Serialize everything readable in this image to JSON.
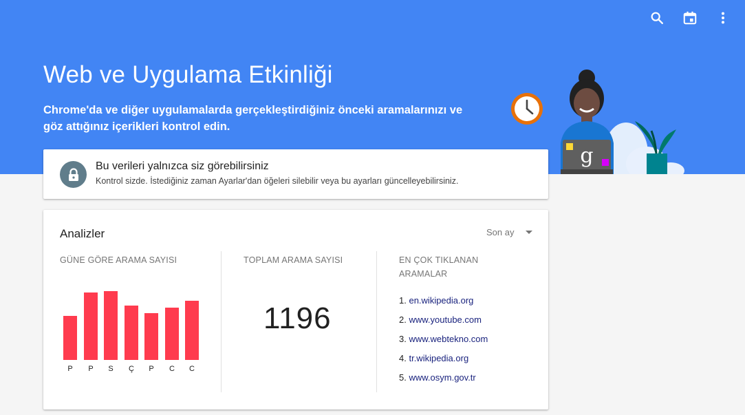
{
  "toolbar": {
    "search_icon": "search-icon",
    "calendar_icon": "calendar-icon",
    "more_icon": "more-vert-icon"
  },
  "header": {
    "title": "Web ve Uygulama Etkinliği",
    "subtitle": "Chrome'da ve diğer uygulamalarda gerçekleştirdiğiniz önceki aramalarınızı ve göz attığınız içerikleri kontrol edin."
  },
  "privacy": {
    "title": "Bu verileri yalnızca siz görebilirsiniz",
    "description": "Kontrol sizde. İstediğiniz zaman Ayarlar'dan öğeleri silebilir veya bu ayarları güncelleyebilirsiniz."
  },
  "analytics": {
    "title": "Analizler",
    "period": "Son ay",
    "daily_header": "GÜNE GÖRE ARAMA SAYISI",
    "total_header": "TOPLAM ARAMA SAYISI",
    "total_value": "1196",
    "top_header_line1": "EN ÇOK TIKLANAN",
    "top_header_line2": "ARAMALAR",
    "top_sites": [
      {
        "num": "1.",
        "site": "en.wikipedia.org"
      },
      {
        "num": "2.",
        "site": "www.youtube.com"
      },
      {
        "num": "3.",
        "site": "www.webtekno.com"
      },
      {
        "num": "4.",
        "site": "tr.wikipedia.org"
      },
      {
        "num": "5.",
        "site": "www.osym.gov.tr"
      }
    ]
  },
  "chart_data": {
    "type": "bar",
    "categories": [
      "P",
      "P",
      "S",
      "Ç",
      "P",
      "C",
      "C"
    ],
    "values": [
      64,
      98,
      100,
      79,
      68,
      76,
      86
    ],
    "ylim": [
      0,
      100
    ],
    "color": "#ff3b4e"
  },
  "colors": {
    "header": "#4285f4",
    "bar": "#ff3b4e",
    "link": "#1a237e",
    "lock": "#607d8b"
  }
}
